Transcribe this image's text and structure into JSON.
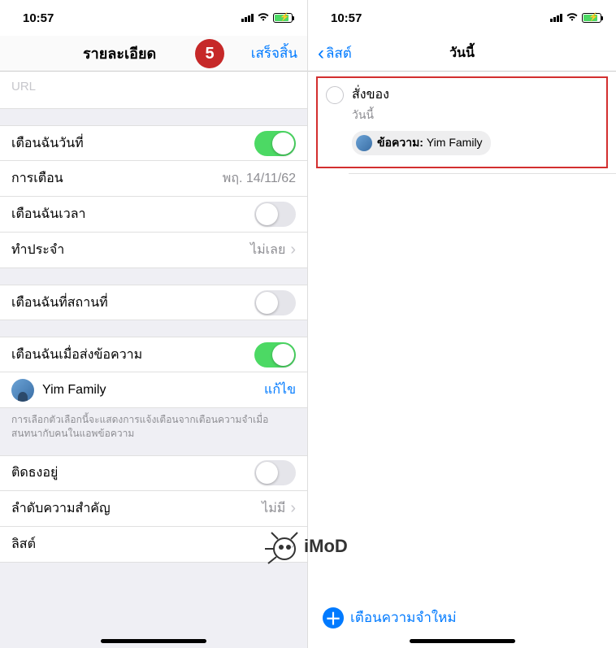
{
  "status": {
    "time": "10:57"
  },
  "left": {
    "nav": {
      "title": "รายละเอียด",
      "done": "เสร็จสิ้น",
      "badge": "5"
    },
    "url_placeholder": "URL",
    "rows": {
      "remind_date": {
        "label": "เตือนฉันวันที่",
        "on": true
      },
      "alarm": {
        "label": "การเตือน",
        "value": "พฤ. 14/11/62"
      },
      "remind_time": {
        "label": "เตือนฉันเวลา",
        "on": false
      },
      "repeat": {
        "label": "ทำประจำ",
        "value": "ไม่เลย"
      },
      "remind_location": {
        "label": "เตือนฉันที่สถานที่",
        "on": false
      },
      "remind_message": {
        "label": "เตือนฉันเมื่อส่งข้อความ",
        "on": true
      },
      "contact": {
        "name": "Yim Family",
        "edit": "แก้ไข"
      },
      "footer": "การเลือกตัวเลือกนี้จะแสดงการแจ้งเตือนจากเตือนความจำเมื่อสนทนากับคนในแอพข้อความ",
      "flag": {
        "label": "ติดธงอยู่",
        "on": false
      },
      "priority": {
        "label": "ลำดับความสำคัญ",
        "value": "ไม่มี"
      },
      "list": {
        "label": "ลิสต์"
      }
    }
  },
  "right": {
    "nav": {
      "back": "ลิสต์",
      "title": "วันนี้"
    },
    "reminder": {
      "title": "สั่งของ",
      "subtitle": "วันนี้",
      "chip_label": "ข้อความ:",
      "chip_value": "Yim Family"
    },
    "new_reminder": "เตือนความจำใหม่"
  },
  "watermark": "iMoD"
}
